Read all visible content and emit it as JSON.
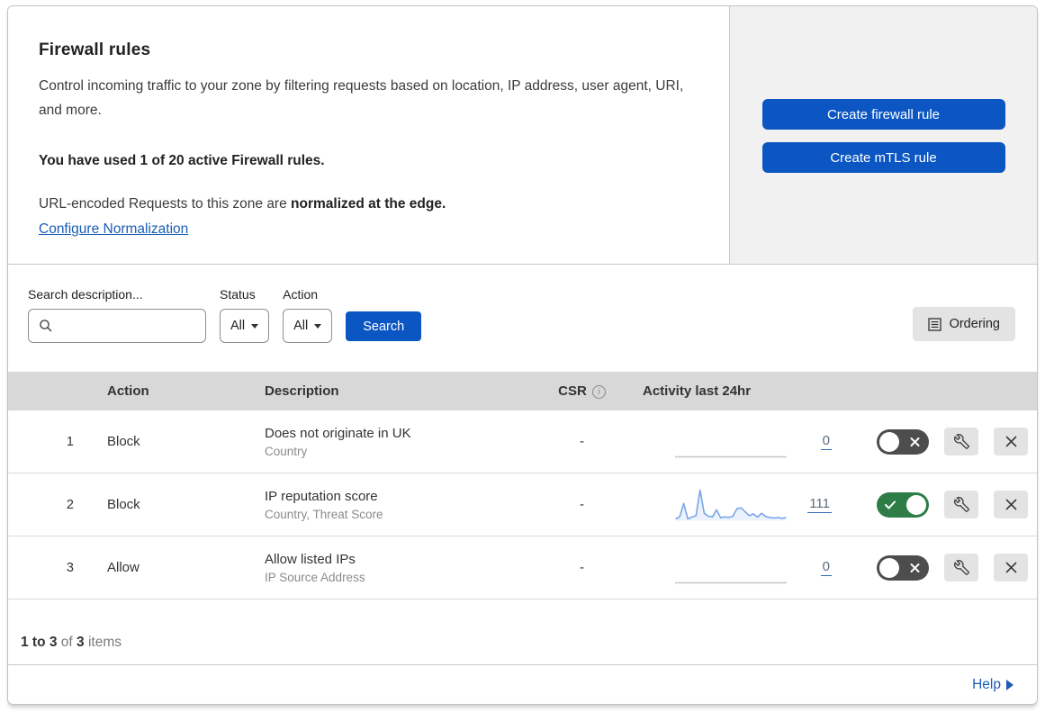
{
  "header": {
    "title": "Firewall rules",
    "description": "Control incoming traffic to your zone by filtering requests based on location, IP address, user agent, URI, and more.",
    "usage_line": "You have used 1 of 20 active Firewall rules.",
    "normalization_text": "URL-encoded Requests to this zone are",
    "normalization_bold": "normalized at the edge.",
    "normalization_link": "Configure Normalization",
    "create_firewall_button": "Create firewall rule",
    "create_mtls_button": "Create mTLS rule"
  },
  "filters": {
    "search_label": "Search description...",
    "search_value": "",
    "status_label": "Status",
    "status_value": "All",
    "action_label": "Action",
    "action_value": "All",
    "search_button": "Search",
    "ordering_button": "Ordering"
  },
  "table": {
    "columns": {
      "action": "Action",
      "description": "Description",
      "csr": "CSR",
      "activity": "Activity last 24hr"
    },
    "rows": [
      {
        "num": "1",
        "action": "Block",
        "description": "Does not originate in UK",
        "fields": "Country",
        "csr": "-",
        "count": "0",
        "enabled": false,
        "sparkline": []
      },
      {
        "num": "2",
        "action": "Block",
        "description": "IP reputation score",
        "fields": "Country, Threat Score",
        "csr": "-",
        "count": "111",
        "enabled": true,
        "sparkline": [
          3,
          10,
          55,
          3,
          9,
          14,
          100,
          22,
          12,
          10,
          34,
          7,
          10,
          8,
          12,
          38,
          40,
          27,
          14,
          20,
          9,
          22,
          11,
          8,
          6,
          8,
          5,
          8
        ]
      },
      {
        "num": "3",
        "action": "Allow",
        "description": "Allow listed IPs",
        "fields": "IP Source Address",
        "csr": "-",
        "count": "0",
        "enabled": false,
        "sparkline": []
      }
    ]
  },
  "footer": {
    "range_bold": "1 to 3",
    "of_text": "of",
    "total_bold": "3",
    "items_text": "items",
    "help_label": "Help"
  },
  "chart_data": {
    "type": "line",
    "title": "Activity last 24hr sparkline (rule 2)",
    "x": "24 hourly samples (relative)",
    "series": [
      {
        "name": "IP reputation score rule activity",
        "values": [
          3,
          10,
          55,
          3,
          9,
          14,
          100,
          22,
          12,
          10,
          34,
          7,
          10,
          8,
          12,
          38,
          40,
          27,
          14,
          20,
          9,
          22,
          11,
          8,
          6,
          8,
          5,
          8
        ],
        "total_label": "111"
      }
    ],
    "legend": false,
    "grid": false
  },
  "colors": {
    "primary_blue": "#0b56c3",
    "link_blue": "#1a5db5",
    "toggle_on_green": "#2e7d46",
    "toggle_off_gray": "#4d4d4d",
    "sparkline_blue": "#7aa5e8",
    "header_panel_gray": "#f1f1f1",
    "table_header_gray": "#d8d8d8"
  }
}
